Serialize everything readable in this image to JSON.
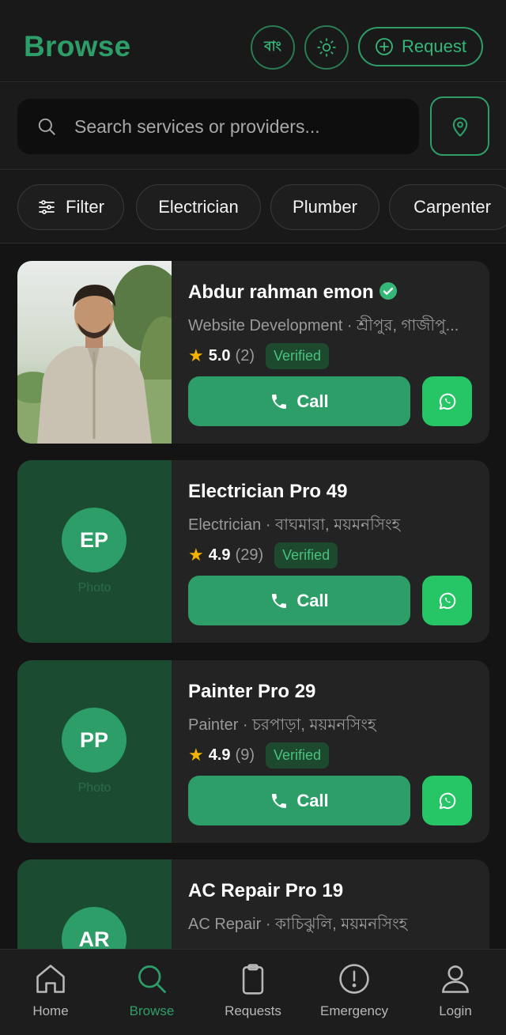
{
  "header": {
    "title": "Browse",
    "lang_label": "বাং",
    "theme_icon": "sun-icon",
    "request_label": "Request"
  },
  "search": {
    "placeholder": "Search services or providers...",
    "value": ""
  },
  "chips": [
    {
      "label": "Filter",
      "icon": "sliders-icon"
    },
    {
      "label": "Electrician"
    },
    {
      "label": "Plumber"
    },
    {
      "label": "Carpenter"
    }
  ],
  "providers": [
    {
      "name": "Abdur rahman emon",
      "service": "Website Development",
      "location": "শ্রীপুর, গাজীপু...",
      "subtitle": "Website Development · শ্রীপুর, গাজীপু...",
      "rating": "5.0",
      "count": "(2)",
      "badge": "Verified",
      "has_photo": true,
      "name_verified_icon": true
    },
    {
      "name": "Electrician Pro 49",
      "subtitle": "Electrician · বাঘমারা, ময়মনসিংহ",
      "rating": "4.9",
      "count": "(29)",
      "badge": "Verified",
      "initials": "EP",
      "photo_label": "Photo"
    },
    {
      "name": "Painter Pro 29",
      "subtitle": "Painter · চরপাড়া, ময়মনসিংহ",
      "rating": "4.9",
      "count": "(9)",
      "badge": "Verified",
      "initials": "PP",
      "photo_label": "Photo"
    },
    {
      "name": "AC Repair Pro 19",
      "subtitle": "AC Repair · কাচিঝুলি, ময়মনসিংহ",
      "initials": "AR"
    }
  ],
  "call_label": "Call",
  "nav": [
    {
      "label": "Home",
      "icon": "home-icon"
    },
    {
      "label": "Browse",
      "icon": "search-icon",
      "active": true
    },
    {
      "label": "Requests",
      "icon": "clipboard-icon"
    },
    {
      "label": "Emergency",
      "icon": "alert-icon"
    },
    {
      "label": "Login",
      "icon": "user-icon"
    }
  ],
  "colors": {
    "accent": "#2e9e68",
    "whatsapp": "#26c565",
    "star": "#f5b301",
    "background": "#141414",
    "card": "#232323"
  }
}
